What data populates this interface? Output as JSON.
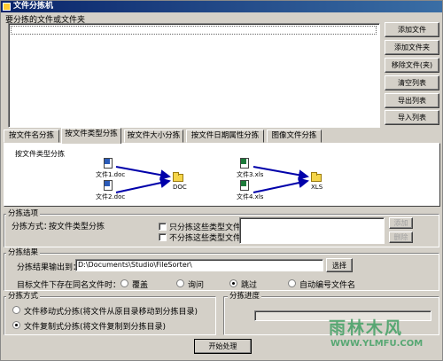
{
  "window": {
    "title": "文件分拣机"
  },
  "source": {
    "label": "要分拣的文件或文件夹",
    "buttons": [
      "添加文件",
      "添加文件夹",
      "移除文件(夹)",
      "清空列表",
      "导出列表",
      "导入列表"
    ]
  },
  "tabs": [
    {
      "label": "按文件名分拣",
      "active": false
    },
    {
      "label": "按文件类型分拣",
      "active": true
    },
    {
      "label": "按文件大小分拣",
      "active": false
    },
    {
      "label": "按文件日期属性分拣",
      "active": false
    },
    {
      "label": "图像文件分拣",
      "active": false
    }
  ],
  "tab_panel": {
    "title": "按文件类型分拣",
    "files": [
      "文件1.doc",
      "文件2.doc",
      "文件3.xls",
      "文件4.xls"
    ],
    "folders": [
      "DOC",
      "XLS"
    ]
  },
  "options": {
    "title": "分拣选项",
    "mode_label": "分拣方式：",
    "mode_value": "按文件类型分拣",
    "only_label": "只分拣这些类型文件：",
    "skip_label": "不分拣这些类型文件：",
    "add_button": "添加",
    "delete_button": "删除"
  },
  "result": {
    "title": "分拣结果",
    "output_label": "分拣结果输出到：",
    "output_path": "D:\\Documents\\Studio\\FileSorter\\",
    "browse_button": "选择",
    "conflict_label": "目标文件下存在同名文件时：",
    "conflict_options": [
      {
        "label": "覆盖",
        "selected": false
      },
      {
        "label": "询问",
        "selected": false
      },
      {
        "label": "跳过",
        "selected": true
      },
      {
        "label": "自动编号文件名",
        "selected": false
      }
    ]
  },
  "method": {
    "title": "分拣方式",
    "options": [
      {
        "label": "文件移动式分拣(将文件从原目录移动到分拣目录)",
        "selected": false
      },
      {
        "label": "文件复制式分拣(将文件复制到分拣目录)",
        "selected": true
      }
    ]
  },
  "progress": {
    "title": "分拣进度"
  },
  "actions": {
    "start_button": "开始处理"
  },
  "watermark": {
    "cn": "雨林木风",
    "url": "WWW.YLMFU.COM"
  }
}
